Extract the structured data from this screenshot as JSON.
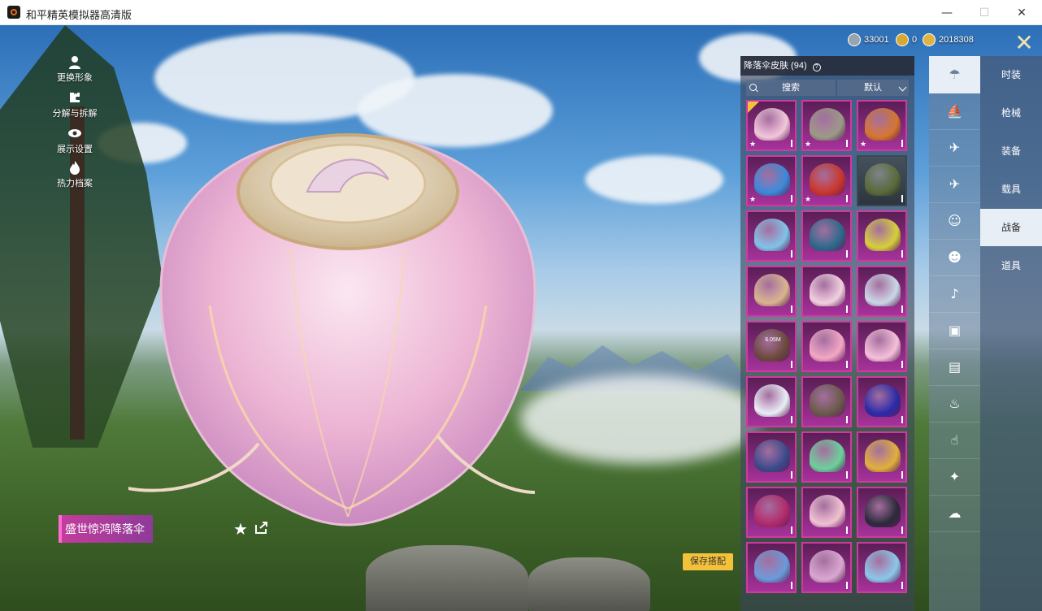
{
  "window": {
    "title": "和平精英模拟器高清版",
    "minimize": "—",
    "maximize": "☐",
    "close": "✕"
  },
  "left_menu": [
    {
      "label": "更换形象",
      "icon": "person-icon"
    },
    {
      "label": "分解与拆解",
      "icon": "puzzle-icon"
    },
    {
      "label": "展示设置",
      "icon": "eye-icon"
    },
    {
      "label": "热力档案",
      "icon": "fire-icon"
    }
  ],
  "currency": [
    {
      "icon": "silver-coin-icon",
      "value": "33001",
      "color": "#9aa4ad"
    },
    {
      "icon": "a-coupon-icon",
      "value": "0",
      "color": "#d6a933"
    },
    {
      "icon": "gold-coin-icon",
      "value": "2018308",
      "color": "#e0b340"
    }
  ],
  "item": {
    "name": "盛世惊鸿降落伞",
    "star": "★"
  },
  "save_button": "保存搭配",
  "panel": {
    "title": "降落伞皮肤 (94)",
    "help": "?",
    "search_placeholder": "搜索",
    "sort_label": "默认"
  },
  "grid": [
    {
      "color": "#f2c7da",
      "star": true,
      "equipped": true
    },
    {
      "color": "#9a9a86",
      "star": true
    },
    {
      "color": "#d5762c",
      "star": true
    },
    {
      "color": "#3a8ad8",
      "star": true
    },
    {
      "color": "#c9362a",
      "star": true
    },
    {
      "color": "#5a6a3a",
      "gray": true
    },
    {
      "color": "#7fc3e6"
    },
    {
      "color": "#2a6a8a"
    },
    {
      "color": "#d6cf3a"
    },
    {
      "color": "#d8b58e"
    },
    {
      "color": "#f0d0de"
    },
    {
      "color": "#c9d8e6"
    },
    {
      "color": "#6a4a3a",
      "download": "6.05M"
    },
    {
      "color": "#f2a7c3"
    },
    {
      "color": "#f5c0d8"
    },
    {
      "color": "#e8eef5"
    },
    {
      "color": "#6a5a4a"
    },
    {
      "color": "#2a2aa8"
    },
    {
      "color": "#3a4a8a"
    },
    {
      "color": "#6ad19a"
    },
    {
      "color": "#e0b03a"
    },
    {
      "color": "#b12a6a"
    },
    {
      "color": "#f0c2d2"
    },
    {
      "color": "#2a2a3a"
    },
    {
      "color": "#6a9ad8"
    },
    {
      "color": "#d8a8d0"
    },
    {
      "color": "#8ac8e8"
    }
  ],
  "categories": [
    {
      "icon": "parachute-icon",
      "glyph": "☂",
      "active": true
    },
    {
      "icon": "boat-icon",
      "glyph": "⛵"
    },
    {
      "icon": "drone-icon",
      "glyph": "✈"
    },
    {
      "icon": "plane-icon",
      "glyph": "✈"
    },
    {
      "icon": "emote-icon",
      "glyph": "☺"
    },
    {
      "icon": "robot-icon",
      "glyph": "☻"
    },
    {
      "icon": "speaker-icon",
      "glyph": "♪"
    },
    {
      "icon": "badge-icon",
      "glyph": "▣"
    },
    {
      "icon": "picture-icon",
      "glyph": "▤"
    },
    {
      "icon": "spray-icon",
      "glyph": "♨"
    },
    {
      "icon": "hand-icon",
      "glyph": "☝"
    },
    {
      "icon": "wand-icon",
      "glyph": "✦"
    },
    {
      "icon": "hat-icon",
      "glyph": "☁"
    }
  ],
  "tabs": [
    {
      "label": "时装"
    },
    {
      "label": "枪械"
    },
    {
      "label": "装备"
    },
    {
      "label": "载具"
    },
    {
      "label": "战备",
      "active": true
    },
    {
      "label": "道具"
    }
  ]
}
